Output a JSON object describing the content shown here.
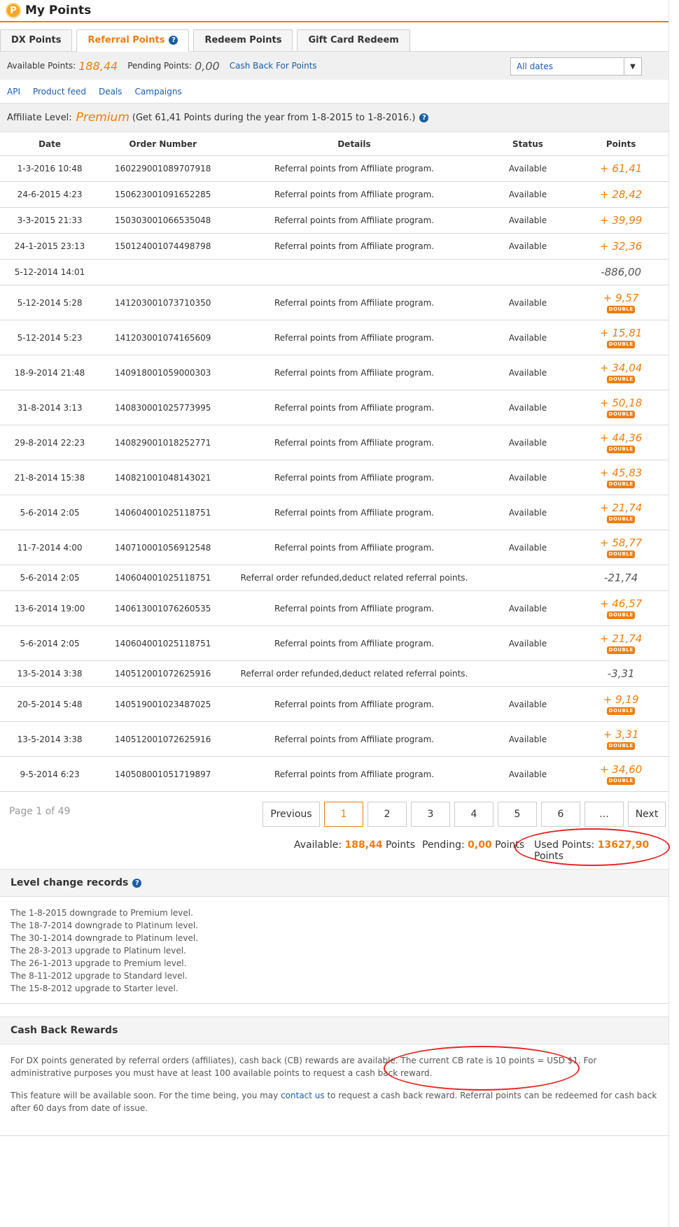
{
  "header": {
    "title": "My Points",
    "logo_letter": "P"
  },
  "tabs": [
    {
      "label": "DX Points"
    },
    {
      "label": "Referral Points"
    },
    {
      "label": "Redeem Points"
    },
    {
      "label": "Gift Card Redeem"
    }
  ],
  "points_bar": {
    "available_label": "Available Points:",
    "available_value": "188,44",
    "pending_label": "Pending Points:",
    "pending_value": "0,00",
    "cash_back_link": "Cash Back For Points",
    "date_filter": "All dates"
  },
  "sublinks": [
    "API",
    "Product feed",
    "Deals",
    "Campaigns"
  ],
  "affiliate": {
    "label": "Affiliate Level:",
    "level": "Premium",
    "note": "(Get 61,41 Points during the year from 1-8-2015 to 1-8-2016.)"
  },
  "table": {
    "headers": [
      "Date",
      "Order Number",
      "Details",
      "Status",
      "Points"
    ],
    "double_badge": "DOUBLE",
    "rows": [
      {
        "date": "1-3-2016 10:48",
        "order": "160229001089707918",
        "details": "Referral points from Affiliate program.",
        "status": "Available",
        "points": "+ 61,41",
        "positive": true,
        "double": false
      },
      {
        "date": "24-6-2015 4:23",
        "order": "150623001091652285",
        "details": "Referral points from Affiliate program.",
        "status": "Available",
        "points": "+ 28,42",
        "positive": true,
        "double": false
      },
      {
        "date": "3-3-2015 21:33",
        "order": "150303001066535048",
        "details": "Referral points from Affiliate program.",
        "status": "Available",
        "points": "+ 39,99",
        "positive": true,
        "double": false
      },
      {
        "date": "24-1-2015 23:13",
        "order": "150124001074498798",
        "details": "Referral points from Affiliate program.",
        "status": "Available",
        "points": "+ 32,36",
        "positive": true,
        "double": false
      },
      {
        "date": "5-12-2014 14:01",
        "order": "",
        "details": "",
        "status": "",
        "points": "-886,00",
        "positive": false,
        "double": false
      },
      {
        "date": "5-12-2014 5:28",
        "order": "141203001073710350",
        "details": "Referral points from Affiliate program.",
        "status": "Available",
        "points": "+ 9,57",
        "positive": true,
        "double": true
      },
      {
        "date": "5-12-2014 5:23",
        "order": "141203001074165609",
        "details": "Referral points from Affiliate program.",
        "status": "Available",
        "points": "+ 15,81",
        "positive": true,
        "double": true
      },
      {
        "date": "18-9-2014 21:48",
        "order": "140918001059000303",
        "details": "Referral points from Affiliate program.",
        "status": "Available",
        "points": "+ 34,04",
        "positive": true,
        "double": true
      },
      {
        "date": "31-8-2014 3:13",
        "order": "140830001025773995",
        "details": "Referral points from Affiliate program.",
        "status": "Available",
        "points": "+ 50,18",
        "positive": true,
        "double": true
      },
      {
        "date": "29-8-2014 22:23",
        "order": "140829001018252771",
        "details": "Referral points from Affiliate program.",
        "status": "Available",
        "points": "+ 44,36",
        "positive": true,
        "double": true
      },
      {
        "date": "21-8-2014 15:38",
        "order": "140821001048143021",
        "details": "Referral points from Affiliate program.",
        "status": "Available",
        "points": "+ 45,83",
        "positive": true,
        "double": true
      },
      {
        "date": "5-6-2014 2:05",
        "order": "140604001025118751",
        "details": "Referral points from Affiliate program.",
        "status": "Available",
        "points": "+ 21,74",
        "positive": true,
        "double": true
      },
      {
        "date": "11-7-2014 4:00",
        "order": "140710001056912548",
        "details": "Referral points from Affiliate program.",
        "status": "Available",
        "points": "+ 58,77",
        "positive": true,
        "double": true
      },
      {
        "date": "5-6-2014 2:05",
        "order": "140604001025118751",
        "details": "Referral order refunded,deduct related referral points.",
        "status": "",
        "points": "-21,74",
        "positive": false,
        "double": false
      },
      {
        "date": "13-6-2014 19:00",
        "order": "140613001076260535",
        "details": "Referral points from Affiliate program.",
        "status": "Available",
        "points": "+ 46,57",
        "positive": true,
        "double": true
      },
      {
        "date": "5-6-2014 2:05",
        "order": "140604001025118751",
        "details": "Referral points from Affiliate program.",
        "status": "Available",
        "points": "+ 21,74",
        "positive": true,
        "double": true
      },
      {
        "date": "13-5-2014 3:38",
        "order": "140512001072625916",
        "details": "Referral order refunded,deduct related referral points.",
        "status": "",
        "points": "-3,31",
        "positive": false,
        "double": false
      },
      {
        "date": "20-5-2014 5:48",
        "order": "140519001023487025",
        "details": "Referral points from Affiliate program.",
        "status": "Available",
        "points": "+ 9,19",
        "positive": true,
        "double": true
      },
      {
        "date": "13-5-2014 3:38",
        "order": "140512001072625916",
        "details": "Referral points from Affiliate program.",
        "status": "Available",
        "points": "+ 3,31",
        "positive": true,
        "double": true
      },
      {
        "date": "9-5-2014 6:23",
        "order": "140508001051719897",
        "details": "Referral points from Affiliate program.",
        "status": "Available",
        "points": "+ 34,60",
        "positive": true,
        "double": true
      }
    ]
  },
  "pagination": {
    "info": "Page 1 of 49",
    "previous": "Previous",
    "next": "Next",
    "pages": [
      "1",
      "2",
      "3",
      "4",
      "5",
      "6",
      "..."
    ],
    "current": "1"
  },
  "summary": {
    "available_label": "Available:",
    "available_value": "188,44",
    "pending_label": "Pending:",
    "pending_value": "0,00",
    "used_label": "Used Points:",
    "used_value": "13627,90",
    "unit": "Points"
  },
  "level_records": {
    "title": "Level change records",
    "items": [
      "The 1-8-2015 downgrade to Premium level.",
      "The 18-7-2014 downgrade to Platinum level.",
      "The 30-1-2014 downgrade to Platinum level.",
      "The 28-3-2013 upgrade to Platinum level.",
      "The 26-1-2013 upgrade to Premium level.",
      "The 8-11-2012 upgrade to Standard level.",
      "The 15-8-2012 upgrade to Starter level."
    ]
  },
  "cash_back": {
    "title": "Cash Back Rewards",
    "p1": "For DX points generated by referral orders (affiliates), cash back (CB) rewards are available. The current CB rate is 10 points = USD $1. For administrative purposes you must have at least 100 available points to request a cash back reward.",
    "p2_before": "This feature will be available soon. For the time being, you may ",
    "p2_link": "contact us",
    "p2_after": " to request a cash back reward. Referral points can be redeemed for cash back after 60 days from date of issue."
  },
  "colors": {
    "accent": "#f07d0f",
    "link": "#1a5ea6",
    "annotation": "#e82424"
  }
}
